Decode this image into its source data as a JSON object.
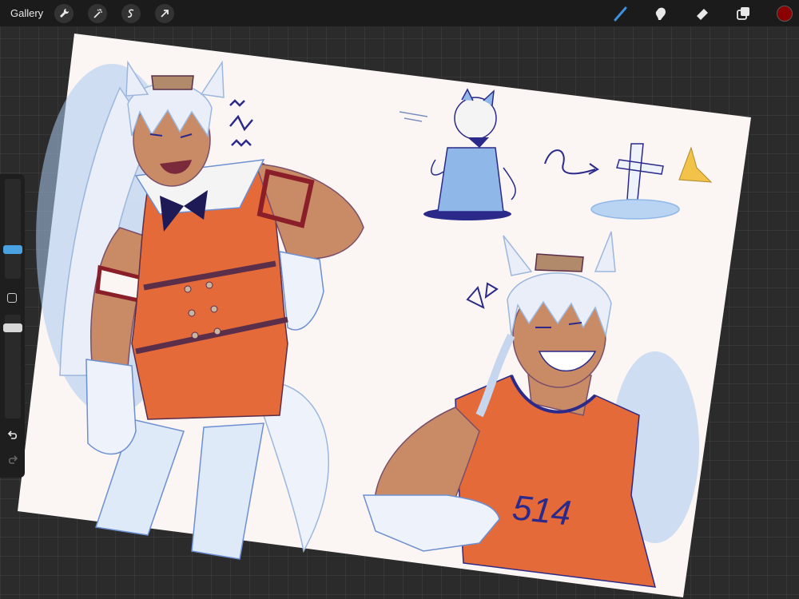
{
  "topbar": {
    "gallery_label": "Gallery",
    "left_tools": [
      "wrench-icon",
      "magic-wand-icon",
      "selection-icon",
      "transform-arrow-icon"
    ],
    "right_tools": [
      "brush-icon",
      "smudge-icon",
      "eraser-icon",
      "layers-icon"
    ],
    "active_tool": "brush-icon",
    "active_color": "#8b0000"
  },
  "sidebar": {
    "brush_size_thumb_color": "#4aa3e0",
    "opacity_thumb_color": "#d8d8d8",
    "modify_icon": "square-icon",
    "undo_icon": "undo-icon",
    "redo_icon": "redo-icon"
  },
  "artwork": {
    "jersey_number": "514",
    "palette": {
      "paper": "#fbf6f3",
      "orange": "#e56a3a",
      "skin": "#c98a66",
      "hair": "#e9eef8",
      "blue_shade": "#8fb8e8",
      "line": "#2b2a8a"
    }
  }
}
